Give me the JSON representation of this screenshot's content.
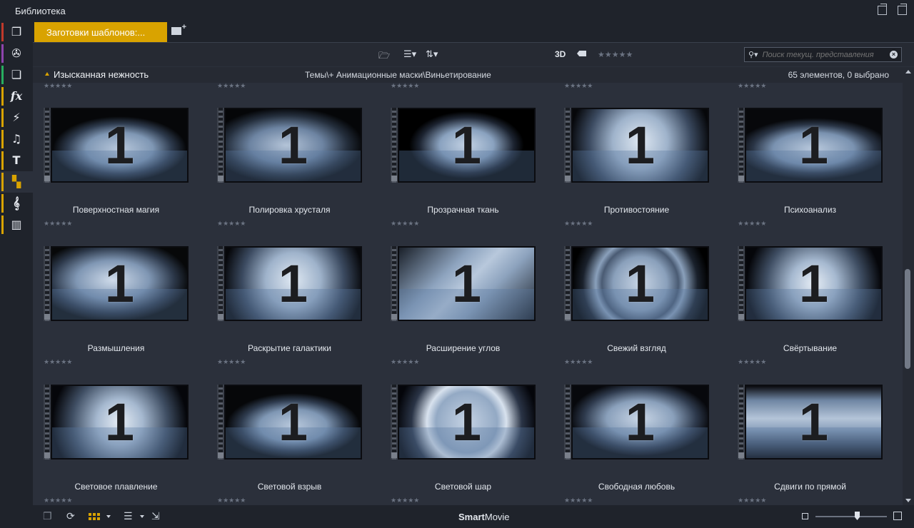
{
  "window": {
    "title": "Библиотека"
  },
  "sidebar": {
    "items": [
      {
        "icon": "package-icon",
        "glyph": "❐",
        "stripe": "#c0392b"
      },
      {
        "icon": "film-reel-icon",
        "glyph": "✇",
        "stripe": "#8e44ad"
      },
      {
        "icon": "stacked-photos-icon",
        "glyph": "❏",
        "stripe": "#27ae60"
      },
      {
        "icon": "fx-icon",
        "glyph": "fx",
        "stripe": "#d9a300"
      },
      {
        "icon": "lightning-icon",
        "glyph": "⚡",
        "stripe": "#d9a300"
      },
      {
        "icon": "music-note-icon",
        "glyph": "♫",
        "stripe": "#d9a300"
      },
      {
        "icon": "text-icon",
        "glyph": "T",
        "stripe": "#d9a300"
      },
      {
        "icon": "montage-templates-icon",
        "glyph": "▚",
        "stripe": "#d9a300"
      },
      {
        "icon": "treble-clef-icon",
        "glyph": "𝄞",
        "stripe": "#d9a300"
      },
      {
        "icon": "piano-keys-icon",
        "glyph": "▥",
        "stripe": "#d9a300"
      }
    ]
  },
  "tabs": {
    "active_label": "Заготовки шаблонов:..."
  },
  "toolbar": {
    "label_3d": "3D",
    "search_placeholder": "Поиск текущ. представления",
    "rating_stars": "★★★★★"
  },
  "group": {
    "title": "Изысканная нежность",
    "path": "Темы\\+ Анимационные маски\\Виньетирование",
    "count": "65 элементов, 0 выбрано"
  },
  "item_stars": "★★★★★",
  "items": [
    {
      "label": "Поверхностная магия",
      "style": "torn"
    },
    {
      "label": "Полировка хрусталя",
      "style": "smoke"
    },
    {
      "label": "Прозрачная ткань",
      "style": "oval"
    },
    {
      "label": "Противостояние",
      "style": "rays"
    },
    {
      "label": "Психоанализ",
      "style": "soft"
    },
    {
      "label": "Размышления",
      "style": "cloud"
    },
    {
      "label": "Раскрытие галактики",
      "style": "rays"
    },
    {
      "label": "Расширение углов",
      "style": "diamond"
    },
    {
      "label": "Свежий взгляд",
      "style": "rings"
    },
    {
      "label": "Свёртывание",
      "style": "burst"
    },
    {
      "label": "Световое плавление",
      "style": "burst"
    },
    {
      "label": "Световой взрыв",
      "style": "torn"
    },
    {
      "label": "Световой шар",
      "style": "sphere"
    },
    {
      "label": "Свободная любовь",
      "style": "hearts"
    },
    {
      "label": "Сдвиги по прямой",
      "style": "streaks"
    }
  ],
  "bottom": {
    "brand_bold": "Smart",
    "brand_rest": "Movie"
  },
  "colors": {
    "accent": "#d9a300",
    "background": "#2b303b",
    "panel": "#1f232b"
  }
}
